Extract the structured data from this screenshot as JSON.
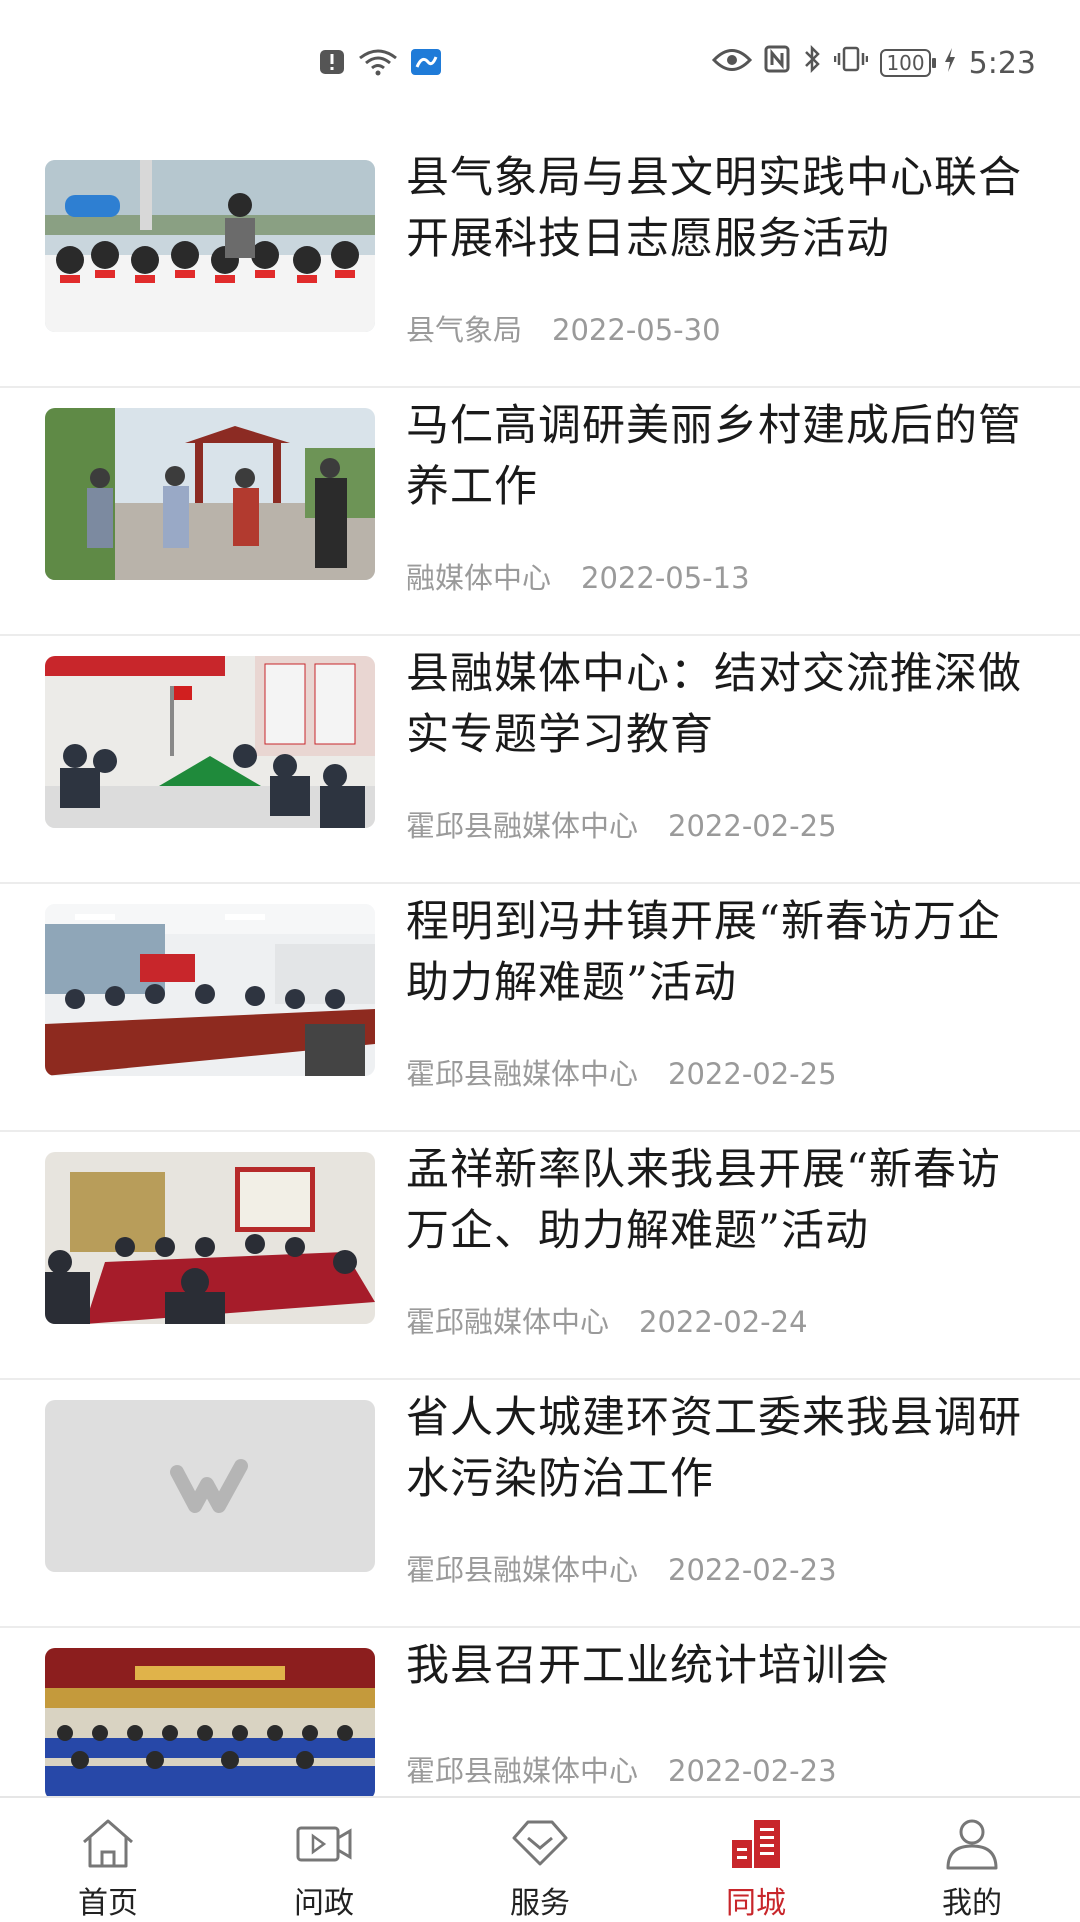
{
  "status_bar": {
    "time": "5:23",
    "battery": "100",
    "icons_left": [
      "alert-icon",
      "wifi-icon",
      "app-notification-icon"
    ],
    "icons_right": [
      "eye-icon",
      "nfc-icon",
      "bluetooth-icon",
      "vibrate-icon",
      "battery-icon",
      "charging-icon"
    ]
  },
  "news": [
    {
      "title": "县气象局与县文明实践中心联合开展科技日志愿服务活动",
      "source": "县气象局",
      "date": "2022-05-30",
      "image": "students-volunteer-photo"
    },
    {
      "title": "马仁高调研美丽乡村建成后的管养工作",
      "source": "融媒体中心",
      "date": "2022-05-13",
      "image": "village-visit-photo"
    },
    {
      "title": "县融媒体中心：结对交流推深做实专题学习教育",
      "source": "霍邱县融媒体中心",
      "date": "2022-02-25",
      "image": "meeting-room-photo"
    },
    {
      "title": "程明到冯井镇开展“新春访万企 助力解难题”活动",
      "source": "霍邱县融媒体中心",
      "date": "2022-02-25",
      "image": "conference-table-photo"
    },
    {
      "title": "孟祥新率队来我县开展“新春访万企、助力解难题”活动",
      "source": "霍邱融媒体中心",
      "date": "2022-02-24",
      "image": "meeting-photo"
    },
    {
      "title": "省人大城建环资工委来我县调研水污染防治工作",
      "source": "霍邱县融媒体中心",
      "date": "2022-02-23",
      "image": "placeholder-logo"
    },
    {
      "title": "我县召开工业统计培训会",
      "source": "霍邱县融媒体中心",
      "date": "2022-02-23",
      "image": "auditorium-photo"
    }
  ],
  "nav": [
    {
      "label": "首页",
      "icon": "home-icon",
      "active": false
    },
    {
      "label": "问政",
      "icon": "video-icon",
      "active": false
    },
    {
      "label": "服务",
      "icon": "service-icon",
      "active": false
    },
    {
      "label": "同城",
      "icon": "city-icon",
      "active": true
    },
    {
      "label": "我的",
      "icon": "profile-icon",
      "active": false
    }
  ],
  "colors": {
    "accent": "#c8262b",
    "text": "#1a1a1a",
    "meta": "#9a9a9a"
  }
}
